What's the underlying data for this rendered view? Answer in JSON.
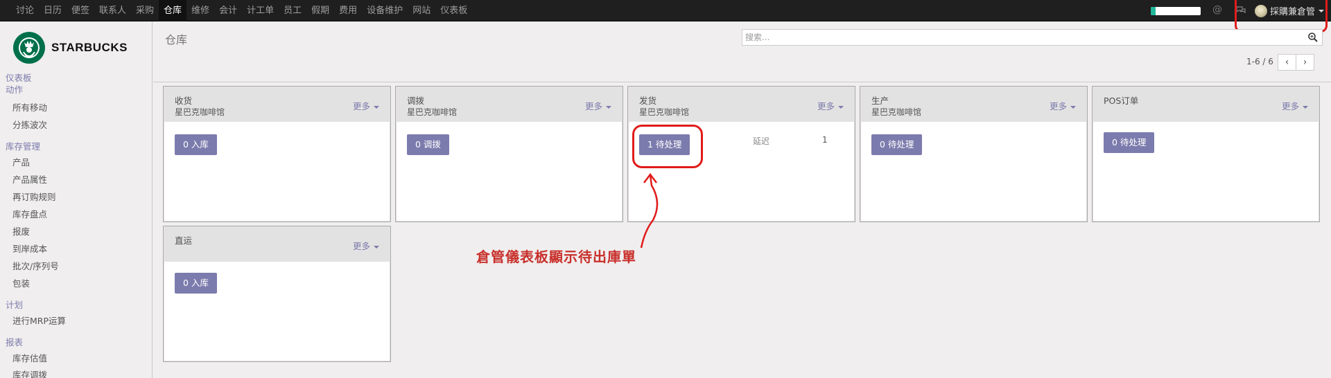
{
  "topbar": {
    "menu": [
      "讨论",
      "日历",
      "便签",
      "联系人",
      "采购",
      "仓库",
      "维修",
      "会计",
      "计工单",
      "员工",
      "假期",
      "费用",
      "设备维护",
      "网站",
      "仪表板"
    ],
    "active_index": 5,
    "progress_fraction": 0.1,
    "at_symbol": "@",
    "user_name": "採購兼倉管"
  },
  "logo": {
    "text": "STARBUCKS"
  },
  "sidebar": {
    "dashboard": "仪表板",
    "actions_head": "动作",
    "actions": [
      "所有移动",
      "分拣波次"
    ],
    "inventory_head": "库存管理",
    "inventory": [
      "产品",
      "产品属性",
      "再订购规则",
      "库存盘点",
      "报废",
      "到岸成本",
      "批次/序列号",
      "包装"
    ],
    "plan_head": "计划",
    "plan": [
      "进行MRP运算"
    ],
    "report_head": "报表",
    "report": [
      "库存估值",
      "库存调拨"
    ]
  },
  "control": {
    "title": "仓库",
    "search_placeholder": "搜索...",
    "pager": "1-6 / 6",
    "prev": "‹",
    "next": "›"
  },
  "cards": [
    {
      "title": "收货",
      "subtitle": "星巴克咖啡馆",
      "more": "更多",
      "button": "0 入库"
    },
    {
      "title": "调拨",
      "subtitle": "星巴克咖啡馆",
      "more": "更多",
      "button": "0 调拨"
    },
    {
      "title": "发货",
      "subtitle": "星巴克咖啡馆",
      "more": "更多",
      "button": "1 待处理",
      "late_label": "延迟",
      "late_count": "1"
    },
    {
      "title": "生产",
      "subtitle": "星巴克咖啡馆",
      "more": "更多",
      "button": "0 待处理"
    },
    {
      "title": "POS订单",
      "subtitle": "",
      "more": "更多",
      "button": "0 待处理"
    },
    {
      "title": "直运",
      "subtitle": "",
      "more": "更多",
      "button": "0 入库"
    }
  ],
  "annotation": {
    "text": "倉管儀表板顯示待出庫單"
  },
  "colors": {
    "accent": "#7c7bad",
    "annotation_red": "#e01b1b",
    "topbar": "#1f1f1f"
  }
}
